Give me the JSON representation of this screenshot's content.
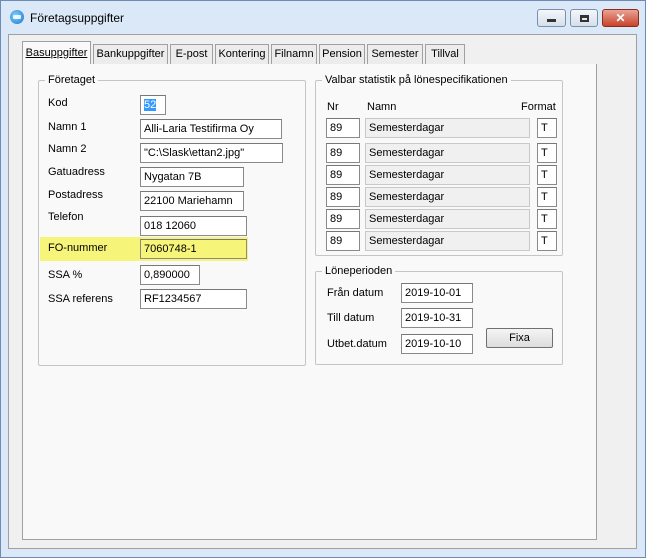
{
  "window": {
    "title": "Företagsuppgifter",
    "close_glyph": "✕"
  },
  "tabs": [
    "Basuppgifter",
    "Bankuppgifter",
    "E-post",
    "Kontering",
    "Filnamn",
    "Pension",
    "Semester",
    "Tillval"
  ],
  "foretaget": {
    "legend": "Företaget",
    "fields": [
      {
        "label": "Kod",
        "value": "52"
      },
      {
        "label": "Namn 1",
        "value": "Alli-Laria Testifirma Oy"
      },
      {
        "label": "Namn 2",
        "value": "\"C:\\Slask\\ettan2.jpg\""
      },
      {
        "label": "Gatuadress",
        "value": "Nygatan 7B"
      },
      {
        "label": "Postadress",
        "value": "22100 Mariehamn"
      },
      {
        "label": "Telefon",
        "value": "018 12060"
      },
      {
        "label": "FO-nummer",
        "value": "7060748-1"
      },
      {
        "label": "SSA %",
        "value": "0,890000"
      },
      {
        "label": "SSA referens",
        "value": "RF1234567"
      }
    ]
  },
  "statistik": {
    "legend": "Valbar statistik på lönespecifikationen",
    "col_nr": "Nr",
    "col_namn": "Namn",
    "col_format": "Format",
    "rows": [
      {
        "nr": "89",
        "namn": "Semesterdagar",
        "format": "T"
      },
      {
        "nr": "89",
        "namn": "Semesterdagar",
        "format": "T"
      },
      {
        "nr": "89",
        "namn": "Semesterdagar",
        "format": "T"
      },
      {
        "nr": "89",
        "namn": "Semesterdagar",
        "format": "T"
      },
      {
        "nr": "89",
        "namn": "Semesterdagar",
        "format": "T"
      },
      {
        "nr": "89",
        "namn": "Semesterdagar",
        "format": "T"
      }
    ]
  },
  "loneperioden": {
    "legend": "Löneperioden",
    "fran_label": "Från datum",
    "fran_value": "2019-10-01",
    "till_label": "Till datum",
    "till_value": "2019-10-31",
    "utbet_label": "Utbet.datum",
    "utbet_value": "2019-10-10",
    "fixa_label": "Fixa"
  },
  "colors": {
    "highlight": "#f7f47a",
    "selection": "#3399ff"
  }
}
